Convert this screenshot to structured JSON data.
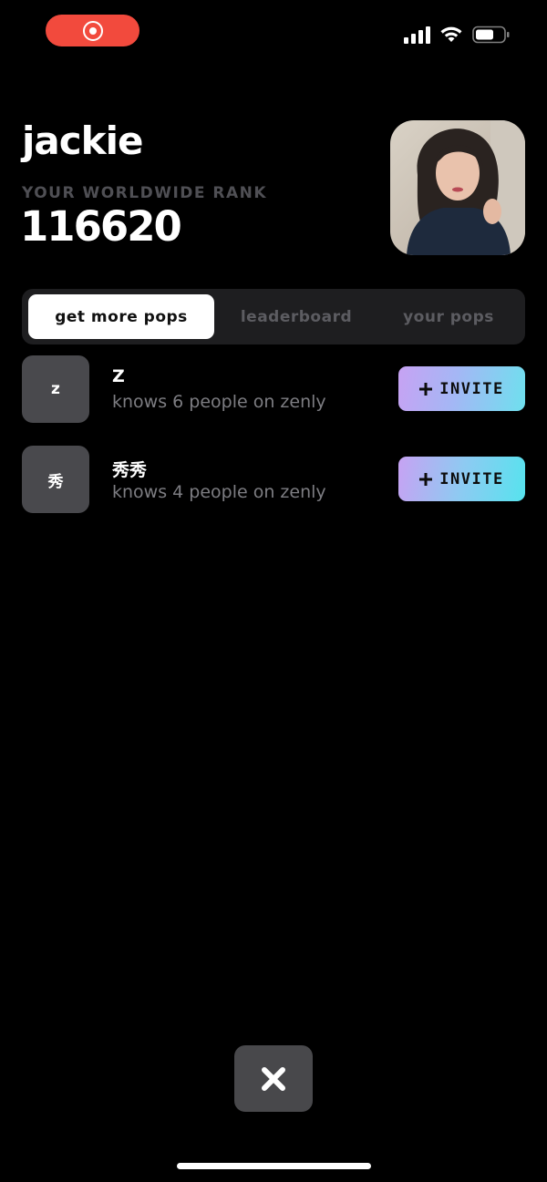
{
  "status_bar": {
    "recording_icon": "record-icon",
    "signal_icon": "cellular-signal-icon",
    "wifi_icon": "wifi-icon",
    "battery_icon": "battery-icon",
    "battery_level": 0.6
  },
  "profile": {
    "name": "jackie",
    "rank_label": "YOUR WORLDWIDE RANK",
    "rank_value": "116620",
    "photo_icon": "profile-photo"
  },
  "tabs": [
    {
      "label": "get more pops",
      "active": true
    },
    {
      "label": "leaderboard",
      "active": false
    },
    {
      "label": "your pops",
      "active": false
    }
  ],
  "contacts": [
    {
      "initial": "z",
      "name": "Z",
      "subtitle": "knows 6 people on zenly",
      "button_label": "INVITE",
      "button_icon": "plus-icon"
    },
    {
      "initial": "秀",
      "name": "秀秀",
      "subtitle": "knows 4 people on zenly",
      "button_label": "INVITE",
      "button_icon": "plus-icon"
    }
  ],
  "close_button": {
    "icon": "close-icon"
  },
  "colors": {
    "background": "#000000",
    "recording": "#f24a3d",
    "invite_gradient_start": "#c7a2f3",
    "invite_gradient_end": "#6ee0ee",
    "tab_bar": "#1e1e20",
    "muted_text": "#7d7d82"
  }
}
